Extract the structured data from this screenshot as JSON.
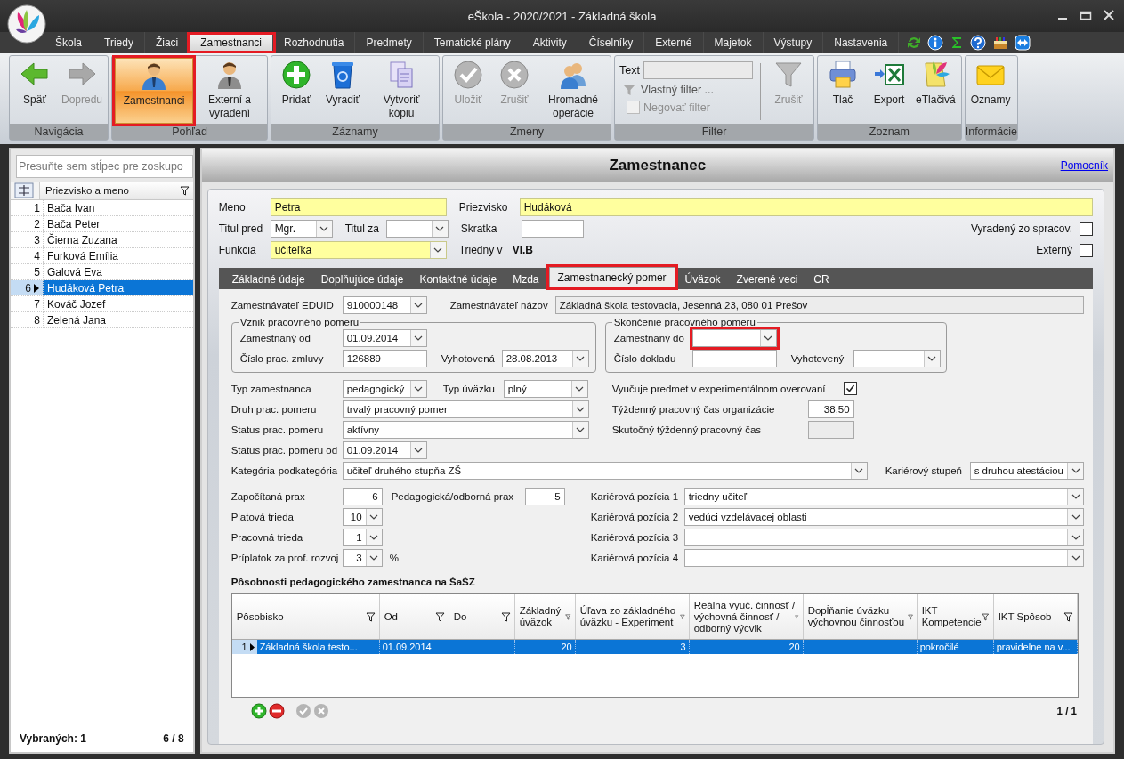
{
  "window": {
    "title": "eŠkola - 2020/2021 - Základná škola"
  },
  "menu": [
    {
      "label": "Škola",
      "selected": false
    },
    {
      "label": "Triedy",
      "selected": false
    },
    {
      "label": "Žiaci",
      "selected": false
    },
    {
      "label": "Zamestnanci",
      "selected": true,
      "highlight": true
    },
    {
      "label": "Rozhodnutia",
      "selected": false
    },
    {
      "label": "Predmety",
      "selected": false
    },
    {
      "label": "Tematické plány",
      "selected": false
    },
    {
      "label": "Aktivity",
      "selected": false
    },
    {
      "label": "Číselníky",
      "selected": false
    },
    {
      "label": "Externé",
      "selected": false
    },
    {
      "label": "Majetok",
      "selected": false
    },
    {
      "label": "Výstupy",
      "selected": false
    },
    {
      "label": "Nastavenia",
      "selected": false
    }
  ],
  "ribbon": [
    {
      "title": "Navigácia",
      "kind": "buttons",
      "buttons": [
        {
          "label": "Späť",
          "kind": "back",
          "disabled": false
        },
        {
          "label": "Dopredu",
          "kind": "forward",
          "disabled": true
        }
      ]
    },
    {
      "title": "Pohľad",
      "kind": "buttons",
      "buttons": [
        {
          "label": "Zamestnanci",
          "kind": "person",
          "disabled": false,
          "selected": true,
          "highlight": true
        },
        {
          "label": "Externí a vyradení",
          "kind": "person-grey",
          "disabled": false,
          "selected": false
        }
      ]
    },
    {
      "title": "Záznamy",
      "kind": "buttons",
      "buttons": [
        {
          "label": "Pridať",
          "kind": "plus",
          "disabled": false
        },
        {
          "label": "Vyradiť",
          "kind": "bin",
          "disabled": false
        },
        {
          "label": "Vytvoriť kópiu",
          "kind": "copy",
          "disabled": false
        }
      ]
    },
    {
      "title": "Zmeny",
      "kind": "buttons",
      "buttons": [
        {
          "label": "Uložiť",
          "kind": "check",
          "disabled": true
        },
        {
          "label": "Zrušiť",
          "kind": "cross",
          "disabled": true
        },
        {
          "label": "Hromadné operácie",
          "kind": "people",
          "disabled": false
        }
      ]
    },
    {
      "title": "Filter",
      "kind": "filter",
      "text_label": "Text",
      "custom": {
        "label": "Vlastný filter ...",
        "disabled": true
      },
      "negate": {
        "label": "Negovať filter",
        "checked": false,
        "disabled": true
      },
      "buttons": [
        {
          "label": "Zrušiť",
          "kind": "funnel",
          "disabled": true
        }
      ]
    },
    {
      "title": "Zoznam",
      "kind": "buttons",
      "buttons": [
        {
          "label": "Tlač",
          "kind": "printer",
          "disabled": false
        },
        {
          "label": "Export",
          "kind": "excel",
          "disabled": false
        },
        {
          "label": "eTlačivá",
          "kind": "forms",
          "disabled": false
        }
      ]
    },
    {
      "title": "Informácie",
      "kind": "buttons",
      "buttons": [
        {
          "label": "Oznamy",
          "kind": "envelope",
          "disabled": false
        }
      ]
    }
  ],
  "list": {
    "group_placeholder": "Presuňte sem stĺpec pre zoskupo",
    "column": "Priezvisko a meno",
    "rows": [
      {
        "number": "1",
        "name": "Bača Ivan",
        "selected": false
      },
      {
        "number": "2",
        "name": "Bača Peter",
        "selected": false
      },
      {
        "number": "3",
        "name": "Čierna Zuzana",
        "selected": false
      },
      {
        "number": "4",
        "name": "Furková Emília",
        "selected": false
      },
      {
        "number": "5",
        "name": "Galová Eva",
        "selected": false
      },
      {
        "number": "6",
        "name": "Hudáková Petra",
        "selected": true
      },
      {
        "number": "7",
        "name": "Kováč Jozef",
        "selected": false
      },
      {
        "number": "8",
        "name": "Zelená Jana",
        "selected": false
      }
    ],
    "footer_left": "Vybraných: 1",
    "footer_right": "6 / 8"
  },
  "header": {
    "title": "Zamestnanec",
    "help_link": "Pomocník"
  },
  "person": {
    "meno": {
      "label": "Meno",
      "value": "Petra",
      "kind": "text",
      "required": true
    },
    "priezvisko": {
      "label": "Priezvisko",
      "value": "Hudáková",
      "kind": "text",
      "required": true
    },
    "titul_pred": {
      "label": "Titul pred",
      "value": "Mgr.",
      "kind": "combo",
      "required": false
    },
    "titul_za": {
      "label": "Titul za",
      "kind": "combo",
      "required": false
    },
    "skratka": {
      "label": "Skratka",
      "kind": "text",
      "required": false
    },
    "funkcia": {
      "label": "Funkcia",
      "value": "učiteľka",
      "kind": "combo",
      "required": true
    },
    "triedny_v": {
      "label": "Triedny v",
      "value": "VI.B"
    },
    "checks": [
      {
        "label": "Vyradený zo spracov.",
        "checked": false
      },
      {
        "label": "Externý",
        "checked": false
      }
    ]
  },
  "tabs": [
    {
      "label": "Základné údaje",
      "selected": false
    },
    {
      "label": "Doplňujúce údaje",
      "selected": false
    },
    {
      "label": "Kontaktné údaje",
      "selected": false
    },
    {
      "label": "Mzda",
      "selected": false
    },
    {
      "label": "Zamestnanecký pomer",
      "selected": true,
      "highlight": true
    },
    {
      "label": "Úväzok",
      "selected": false
    },
    {
      "label": "Zverené veci",
      "selected": false
    },
    {
      "label": "CR",
      "selected": false
    }
  ],
  "employment": {
    "eduid": {
      "label": "Zamestnávateľ EDUID",
      "value": "910000148",
      "kind": "combo"
    },
    "nazov": {
      "label": "Zamestnávateľ názov",
      "value": "Základná škola testovacia, Jesenná 23, 080 01 Prešov",
      "kind": "text",
      "disabled": true
    },
    "vznik": {
      "title": "Vznik pracovného pomeru",
      "od": {
        "label": "Zamestnaný od",
        "value": "01.09.2014",
        "kind": "combo"
      },
      "zmluva": {
        "label": "Číslo prac. zmluvy",
        "value": "126889",
        "kind": "text"
      },
      "vyhotovena": {
        "label": "Vyhotovená",
        "value": "28.08.2013",
        "kind": "combo"
      }
    },
    "skoncenie": {
      "title": "Skončenie pracovného pomeru",
      "do": {
        "label": "Zamestnaný do",
        "kind": "combo",
        "highlight": true
      },
      "doklad": {
        "label": "Číslo dokladu",
        "kind": "text"
      },
      "vyhotoveny": {
        "label": "Vyhotovený",
        "kind": "combo"
      }
    },
    "typ_zamestnanca": {
      "label": "Typ zamestnanca",
      "value": "pedagogický",
      "kind": "combo"
    },
    "typ_uvazku": {
      "label": "Typ úväzku",
      "value": "plný",
      "kind": "combo"
    },
    "druh": {
      "label": "Druh prac. pomeru",
      "value": "trvalý pracovný pomer",
      "kind": "combo"
    },
    "status": {
      "label": "Status prac. pomeru",
      "value": "aktívny",
      "kind": "combo"
    },
    "status_od": {
      "label": "Status prac. pomeru od",
      "value": "01.09.2014",
      "kind": "combo"
    },
    "experiment": {
      "label": "Vyučuje predmet v experimentálnom overovaní",
      "checked": true
    },
    "tyzdenny": {
      "label": "Týždenný pracovný čas organizácie",
      "value": "38,50",
      "kind": "text"
    },
    "skutocny": {
      "label": "Skutočný týždenný pracovný čas",
      "kind": "text",
      "disabled": true
    },
    "kategoria": {
      "label": "Kategória-podkategória",
      "value": "učiteľ druhého stupňa ZŠ",
      "kind": "combo"
    },
    "karierovy_stupen": {
      "label": "Kariérový stupeň",
      "value": "s druhou atestáciou",
      "kind": "combo"
    },
    "zapocitana": {
      "label": "Započítaná prax",
      "value": "6",
      "kind": "text"
    },
    "pedagogicka": {
      "label": "Pedagogická/odborná prax",
      "value": "5",
      "kind": "text"
    },
    "platova": {
      "label": "Platová trieda",
      "value": "10",
      "kind": "combo"
    },
    "pracovna": {
      "label": "Pracovná trieda",
      "value": "1",
      "kind": "combo"
    },
    "priplatok": {
      "label": "Príplatok za prof. rozvoj",
      "value": "3",
      "kind": "combo",
      "unit": "%"
    },
    "pozicie": [
      {
        "label": "Kariérová pozícia 1",
        "value": "triedny učiteľ",
        "kind": "combo"
      },
      {
        "label": "Kariérová pozícia 2",
        "value": "vedúci vzdelávacej oblasti",
        "kind": "combo"
      },
      {
        "label": "Kariérová pozícia 3",
        "kind": "combo"
      },
      {
        "label": "Kariérová pozícia 4",
        "kind": "combo"
      }
    ]
  },
  "grid": {
    "title": "Pôsobnosti pedagogického zamestnanca na ŠaŠZ",
    "columns": [
      "Pôsobisko",
      "Od",
      "Do",
      "Základný úväzok",
      "Úľava zo základného úväzku - Experiment",
      "Reálna vyuč. činnosť / výchovná činnosť / odborný výcvik",
      "Dopĺňanie úväzku výchovnou činnosťou",
      "IKT Kompetencie",
      "IKT Spôsob"
    ],
    "rows": [
      {
        "number": "1",
        "selected": true,
        "cells": [
          "Základná škola testo...",
          "01.09.2014",
          null,
          "20",
          "3",
          "20",
          null,
          "pokročilé",
          "pravidelne na v..."
        ]
      }
    ],
    "pager": "1 / 1"
  }
}
